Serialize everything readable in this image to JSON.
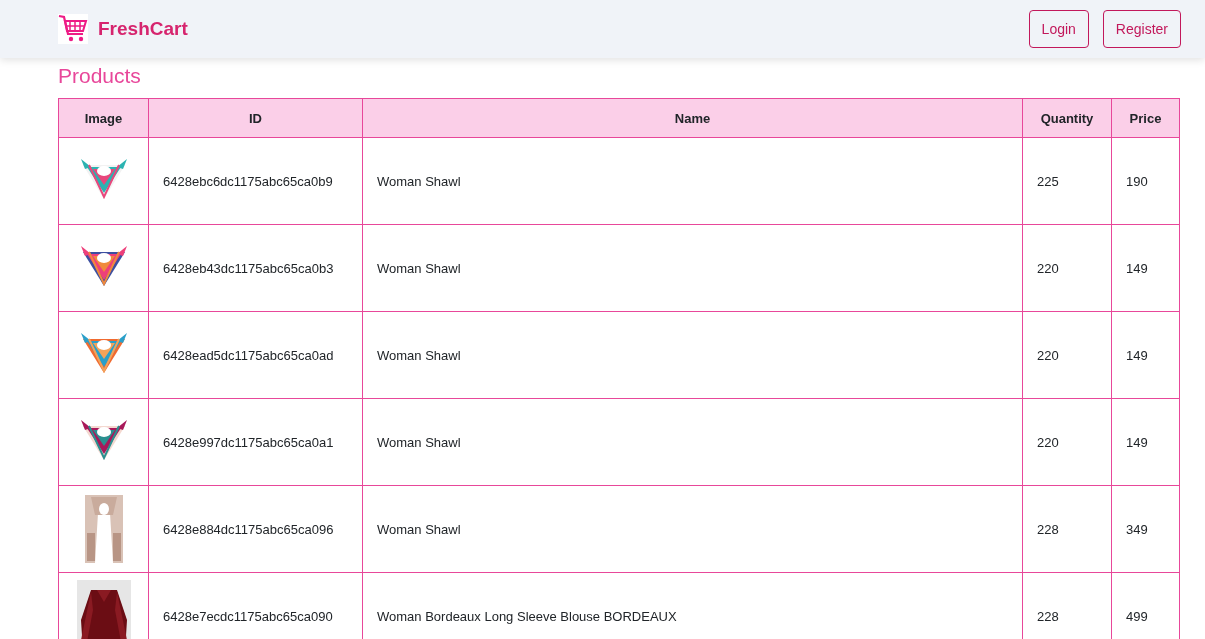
{
  "brand": "FreshCart",
  "nav": [
    {
      "label": "Login"
    },
    {
      "label": "Register"
    }
  ],
  "title": "Products",
  "table": {
    "columns": [
      "Image",
      "ID",
      "Name",
      "Quantity",
      "Price"
    ],
    "rows": [
      {
        "id": "6428ebc6dc1175abc65ca0b9",
        "name": "Woman Shawl",
        "quantity": "225",
        "price": "190"
      },
      {
        "id": "6428eb43dc1175abc65ca0b3",
        "name": "Woman Shawl",
        "quantity": "220",
        "price": "149"
      },
      {
        "id": "6428ead5dc1175abc65ca0ad",
        "name": "Woman Shawl",
        "quantity": "220",
        "price": "149"
      },
      {
        "id": "6428e997dc1175abc65ca0a1",
        "name": "Woman Shawl",
        "quantity": "220",
        "price": "149"
      },
      {
        "id": "6428e884dc1175abc65ca096",
        "name": "Woman Shawl",
        "quantity": "228",
        "price": "349"
      },
      {
        "id": "6428e7ecdc1175abc65ca090",
        "name": "Woman Bordeaux Long Sleeve Blouse BORDEAUX",
        "quantity": "228",
        "price": "499"
      }
    ]
  }
}
